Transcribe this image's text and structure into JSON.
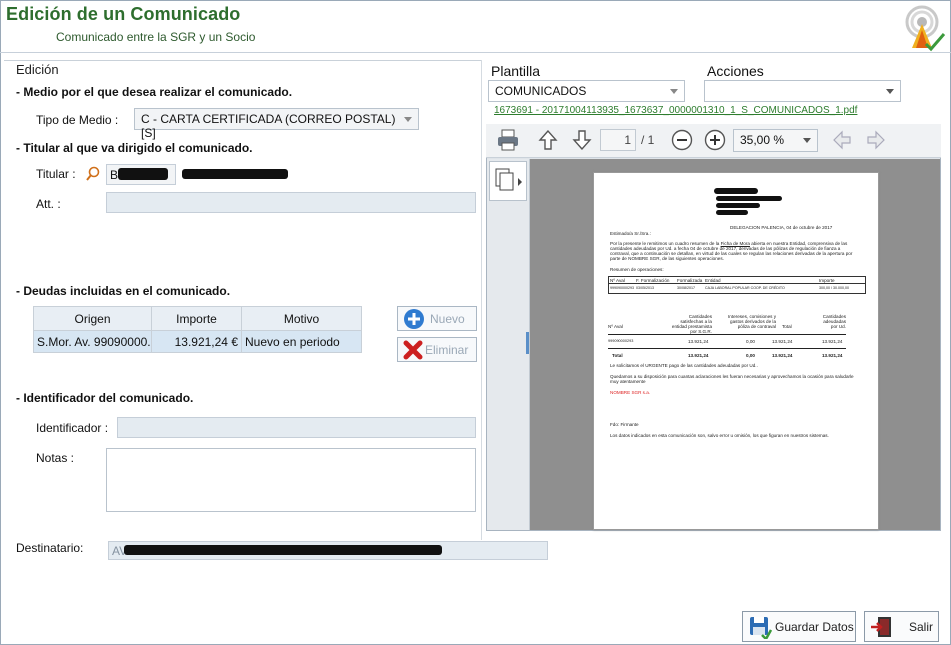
{
  "window": {
    "title": "Edición de un Comunicado",
    "subtitle": "Comunicado entre la SGR y un Socio"
  },
  "left": {
    "group_title": "Edición",
    "medio": {
      "heading": "- Medio por el que desea realizar el comunicado.",
      "label": "Tipo de Medio :",
      "value": "C - CARTA CERTIFICADA  (CORREO POSTAL)  [S]"
    },
    "titular": {
      "heading": "- Titular al que va dirigido el comunicado.",
      "label": "Titular :",
      "code": "B0",
      "att_label": "Att. :"
    },
    "deudas": {
      "heading": "- Deudas incluidas en el comunicado.",
      "columns": [
        "Origen",
        "Importe",
        "Motivo"
      ],
      "rows": [
        {
          "origen": "S.Mor. Av. 99090000...",
          "importe": "13.921,24 €",
          "motivo": "Nuevo en periodo"
        }
      ],
      "btn_nuevo": "Nuevo",
      "btn_eliminar": "Eliminar"
    },
    "identificador": {
      "heading": "- Identificador del comunicado.",
      "label": "Identificador :",
      "notas_label": "Notas :"
    },
    "destinatario": {
      "label": "Destinatario:",
      "value": "AV"
    }
  },
  "right": {
    "plantilla_label": "Plantilla",
    "plantilla_value": "COMUNICADOS",
    "acciones_label": "Acciones",
    "acciones_value": "",
    "file_link": "1673691 - 20171004113935_1673637_0000001310_1_S_COMUNICADOS_1.pdf",
    "viewer": {
      "page_current": "1",
      "page_total": "/ 1",
      "zoom": "35,00 %"
    },
    "pdf": {
      "place_date": "DELEGACION PALENCIA, 04 de octubre de 2017",
      "greeting": "Estimado/a Sr./Sra.:",
      "body1": "Por la presente le remitimos un cuadro resumen de la",
      "body1b": "Ficha de Mora",
      "body1c": " abierta en nuestra Entidad, comprensiva de las",
      "body2": "cantidades adeudadas por Ud. a fecha 04 de octubre de 2017, derivadas de las pólizas de regulación de fianza a",
      "body3": "contraval, que a continuación se detallan, en virtud de las cuales se regulan las relaciones derivadas de la apertura por",
      "body4a": "parte de ",
      "body4b": "NOMBRE SGR",
      "body4c": ", de las siguientes operaciones.",
      "resumen": "Resumen de operaciones:",
      "t1_cols": [
        "Nº Aval",
        "F. Formalización",
        "Formalizada",
        "Entidad",
        "Importe"
      ],
      "t1_row": [
        "999090000293",
        "03/05/2013",
        "30/08/2017",
        "CAJA LABORAL POPULAR COOP. DE CRÉDITO",
        "300,00 / 30.000,00"
      ],
      "t2_cols": [
        "Nº Aval",
        "Cantidades satisfechas a la entidad prestamista por S.G.R.",
        "Intereses, comisiones y gastos derivados de la póliza de contraval",
        "Total",
        "Cantidades adeudadas por Ud."
      ],
      "t2_row": [
        "999090000293",
        "13.921,24",
        "0,00",
        "13.921,24",
        "13.921,24"
      ],
      "t2_total": [
        "Total",
        "13.921,24",
        "0,00",
        "13.921,24",
        "13.921,24"
      ],
      "urgent": "Le solicitamos el URGENTE pago de las cantidades adeudadas por Ud..",
      "closing1": "Quedamos a su disposición para cuantas aclaraciones les fueran necesarias y aprovechamos la ocasión para saludarle",
      "closing2": "muy atentamente",
      "sgr": "NOMBRE SGR s.a.",
      "firma_a": "Fdo: ",
      "firma_b": "Firmante",
      "legal": "Los datos indicados en esta comunicación son, salvo error u omisión, los que figuran en nuestros sistemas."
    }
  },
  "footer": {
    "save": "Guardar Datos",
    "exit": "Salir"
  },
  "colors": {
    "title_green": "#2e6e2e",
    "selection_blue": "#d7e6f3",
    "field_bg": "#e4ebf1"
  }
}
